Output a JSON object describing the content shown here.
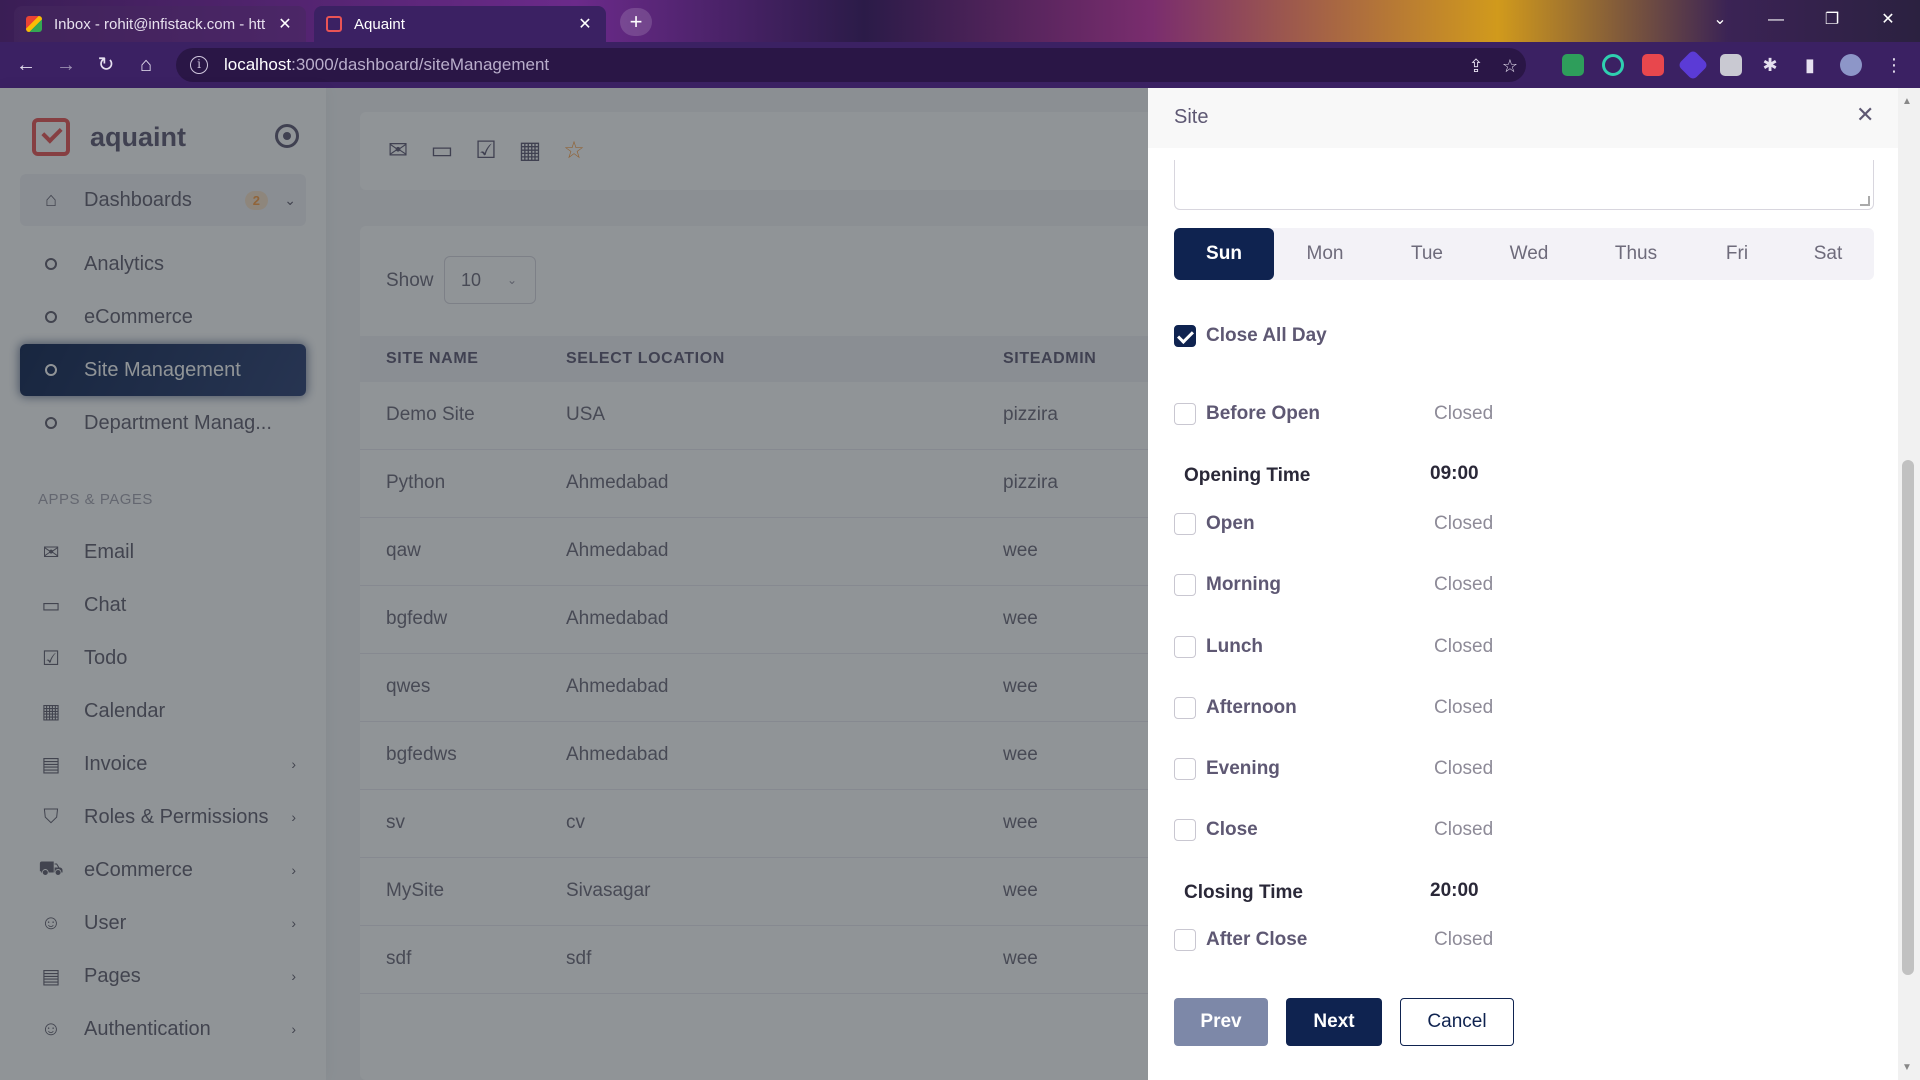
{
  "browser": {
    "tabs": [
      {
        "title": "Inbox - rohit@infistack.com - htt",
        "active": false
      },
      {
        "title": "Aquaint",
        "active": true
      }
    ],
    "url_host": "localhost",
    "url_path": ":3000/dashboard/siteManagement"
  },
  "sidebar": {
    "brand": "aquaint",
    "dashboards": {
      "label": "Dashboards",
      "badge": "2"
    },
    "sub_items": [
      {
        "label": "Analytics"
      },
      {
        "label": "eCommerce"
      },
      {
        "label": "Site Management"
      },
      {
        "label": "Department Manag..."
      }
    ],
    "section_title": "APPS & PAGES",
    "apps": [
      {
        "label": "Email",
        "icon": "mail-icon"
      },
      {
        "label": "Chat",
        "icon": "chat-icon"
      },
      {
        "label": "Todo",
        "icon": "check-square-icon"
      },
      {
        "label": "Calendar",
        "icon": "calendar-icon"
      },
      {
        "label": "Invoice",
        "icon": "file-icon"
      },
      {
        "label": "Roles & Permissions",
        "icon": "shield-icon"
      },
      {
        "label": "eCommerce",
        "icon": "cart-icon"
      },
      {
        "label": "User",
        "icon": "user-icon"
      },
      {
        "label": "Pages",
        "icon": "file-icon"
      },
      {
        "label": "Authentication",
        "icon": "user-check-icon"
      }
    ]
  },
  "table": {
    "show_label": "Show",
    "page_size": "10",
    "headers": [
      "SITE NAME",
      "SELECT LOCATION",
      "SITEADMIN"
    ],
    "rows": [
      [
        "Demo Site",
        "USA",
        "pizzira"
      ],
      [
        "Python",
        "Ahmedabad",
        "pizzira"
      ],
      [
        "qaw",
        "Ahmedabad",
        "wee"
      ],
      [
        "bgfedw",
        "Ahmedabad",
        "wee"
      ],
      [
        "qwes",
        "Ahmedabad",
        "wee"
      ],
      [
        "bgfedws",
        "Ahmedabad",
        "wee"
      ],
      [
        "sv",
        "cv",
        "wee"
      ],
      [
        "MySite",
        "Sivasagar",
        "wee"
      ],
      [
        "sdf",
        "sdf",
        "wee"
      ]
    ]
  },
  "modal": {
    "title": "Site",
    "days": [
      "Sun",
      "Mon",
      "Tue",
      "Wed",
      "Thus",
      "Fri",
      "Sat"
    ],
    "active_day": "Sun",
    "close_all_day": {
      "label": "Close All Day",
      "checked": true
    },
    "before_open": {
      "label": "Before Open",
      "status": "Closed"
    },
    "opening_time": {
      "label": "Opening Time",
      "value": "09:00"
    },
    "slots": [
      {
        "label": "Open",
        "status": "Closed"
      },
      {
        "label": "Morning",
        "status": "Closed"
      },
      {
        "label": "Lunch",
        "status": "Closed"
      },
      {
        "label": "Afternoon",
        "status": "Closed"
      },
      {
        "label": "Evening",
        "status": "Closed"
      },
      {
        "label": "Close",
        "status": "Closed"
      }
    ],
    "closing_time": {
      "label": "Closing Time",
      "value": "20:00"
    },
    "after_close": {
      "label": "After Close",
      "status": "Closed"
    },
    "buttons": {
      "prev": "Prev",
      "next": "Next",
      "cancel": "Cancel"
    }
  },
  "colors": {
    "primary": "#0f2350",
    "danger": "#ea5455",
    "warning": "#ff9f43"
  }
}
